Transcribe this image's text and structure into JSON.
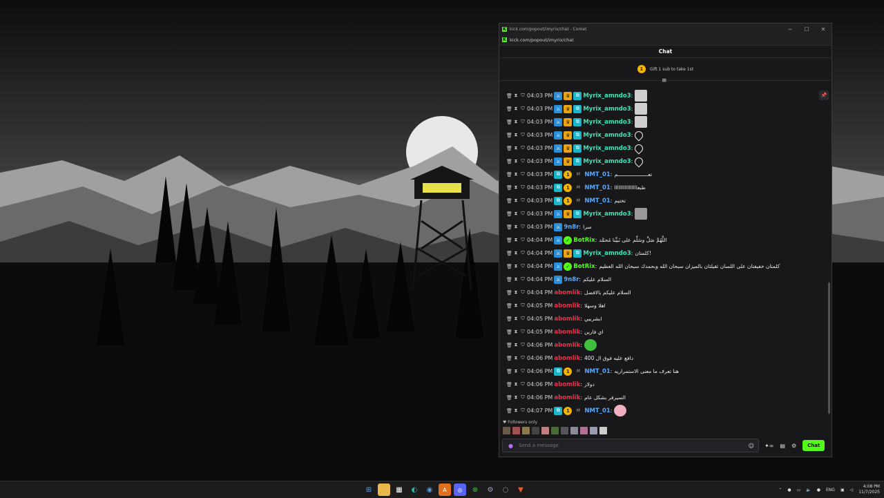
{
  "browser": {
    "title": "kick.com/popout/imyrix/chat - Comet",
    "url": "kick.com/popout/imyrix/chat"
  },
  "chat": {
    "header": "Chat",
    "gift_text": "Gift 1 sub to take 1st",
    "gift_rank": "1",
    "followers_only": "Followers only",
    "input_placeholder": "Send a message",
    "send_label": "Chat",
    "messages": [
      {
        "time": "04:03 PM",
        "user": "Myrix_amndo3",
        "color": "#3ee6b8",
        "badges": [
          "sword",
          "crown",
          "sub"
        ],
        "text": "",
        "emote": "cat"
      },
      {
        "time": "04:03 PM",
        "user": "Myrix_amndo3",
        "color": "#3ee6b8",
        "badges": [
          "sword",
          "crown",
          "sub"
        ],
        "text": "",
        "emote": "cat"
      },
      {
        "time": "04:03 PM",
        "user": "Myrix_amndo3",
        "color": "#3ee6b8",
        "badges": [
          "sword",
          "crown",
          "sub"
        ],
        "text": "",
        "emote": "cat"
      },
      {
        "time": "04:03 PM",
        "user": "Myrix_amndo3",
        "color": "#3ee6b8",
        "badges": [
          "sword",
          "crown",
          "sub"
        ],
        "text": "",
        "emote": "heart"
      },
      {
        "time": "04:03 PM",
        "user": "Myrix_amndo3",
        "color": "#3ee6b8",
        "badges": [
          "sword",
          "crown",
          "sub"
        ],
        "text": "",
        "emote": "heart"
      },
      {
        "time": "04:03 PM",
        "user": "Myrix_amndo3",
        "color": "#3ee6b8",
        "badges": [
          "sword",
          "crown",
          "sub"
        ],
        "text": "",
        "emote": "heart"
      },
      {
        "time": "04:03 PM",
        "user": "NMT_01",
        "color": "#5aa9ff",
        "badges": [
          "sub",
          "coin",
          "m"
        ],
        "text": "تعــــــــــــــــــــم",
        "emote": ""
      },
      {
        "time": "04:03 PM",
        "user": "NMT_01",
        "color": "#5aa9ff",
        "badges": [
          "sub",
          "coin",
          "m"
        ],
        "text": "طبعاااااااااااااااا",
        "emote": ""
      },
      {
        "time": "04:03 PM",
        "user": "NMT_01",
        "color": "#5aa9ff",
        "badges": [
          "sub",
          "coin",
          "m"
        ],
        "text": "تختيم",
        "emote": ""
      },
      {
        "time": "04:03 PM",
        "user": "Myrix_amndo3",
        "color": "#3ee6b8",
        "badges": [
          "sword",
          "crown",
          "sub"
        ],
        "text": "",
        "emote": "face"
      },
      {
        "time": "04:03 PM",
        "user": "9n8r",
        "color": "#5aa9ff",
        "badges": [
          "sword"
        ],
        "text": "سرا",
        "emote": ""
      },
      {
        "time": "04:04 PM",
        "user": "BotRix",
        "color": "#53fc18",
        "badges": [
          "sword",
          "bot"
        ],
        "text": "اللَّهُمَّ صَلِّ وسَلِّم على نَبيِّنا مُحمَّد",
        "emote": ""
      },
      {
        "time": "04:04 PM",
        "user": "Myrix_amndo3",
        "color": "#3ee6b8",
        "badges": [
          "sword",
          "crown",
          "sub"
        ],
        "text": "كلمتان!",
        "emote": ""
      },
      {
        "time": "04:04 PM",
        "user": "BotRix",
        "color": "#53fc18",
        "badges": [
          "sword",
          "bot"
        ],
        "text": "كلمتان خفيفتان على اللسان ثقيلتان بالميزان سبحان الله وبحمدك سبحان الله العظيم",
        "emote": ""
      },
      {
        "time": "04:04 PM",
        "user": "9n8r",
        "color": "#5aa9ff",
        "badges": [
          "sword"
        ],
        "text": "السلام عليكم",
        "emote": ""
      },
      {
        "time": "04:04 PM",
        "user": "abomlik",
        "color": "#e8334a",
        "badges": [],
        "text": "السلام عليكم بالافضل",
        "emote": ""
      },
      {
        "time": "04:05 PM",
        "user": "abomlik",
        "color": "#e8334a",
        "badges": [],
        "text": "اهلا وسهلا",
        "emote": ""
      },
      {
        "time": "04:05 PM",
        "user": "abomlik",
        "color": "#e8334a",
        "badges": [],
        "text": "ابشربيي",
        "emote": ""
      },
      {
        "time": "04:05 PM",
        "user": "abomlik",
        "color": "#e8334a",
        "badges": [],
        "text": "اي فارين",
        "emote": ""
      },
      {
        "time": "04:06 PM",
        "user": "abomlik",
        "color": "#e8334a",
        "badges": [],
        "text": "",
        "emote": "green"
      },
      {
        "time": "04:06 PM",
        "user": "abomlik",
        "color": "#e8334a",
        "badges": [],
        "text": "دافع عليه فوق ال 400",
        "emote": ""
      },
      {
        "time": "04:06 PM",
        "user": "NMT_01",
        "color": "#5aa9ff",
        "badges": [
          "sub",
          "coin",
          "m"
        ],
        "text": "هنا تعرف ما معنى الاستمراريه",
        "emote": ""
      },
      {
        "time": "04:06 PM",
        "user": "abomlik",
        "color": "#e8334a",
        "badges": [],
        "text": "دولار",
        "emote": ""
      },
      {
        "time": "04:06 PM",
        "user": "abomlik",
        "color": "#e8334a",
        "badges": [],
        "text": "السيرفر بشكل عام",
        "emote": ""
      },
      {
        "time": "04:07 PM",
        "user": "NMT_01",
        "color": "#5aa9ff",
        "badges": [
          "sub",
          "coin",
          "m"
        ],
        "text": "",
        "emote": "pig"
      }
    ]
  },
  "taskbar": {
    "lang": "ENG",
    "time": "4:08 PM",
    "date": "11/7/2025"
  }
}
